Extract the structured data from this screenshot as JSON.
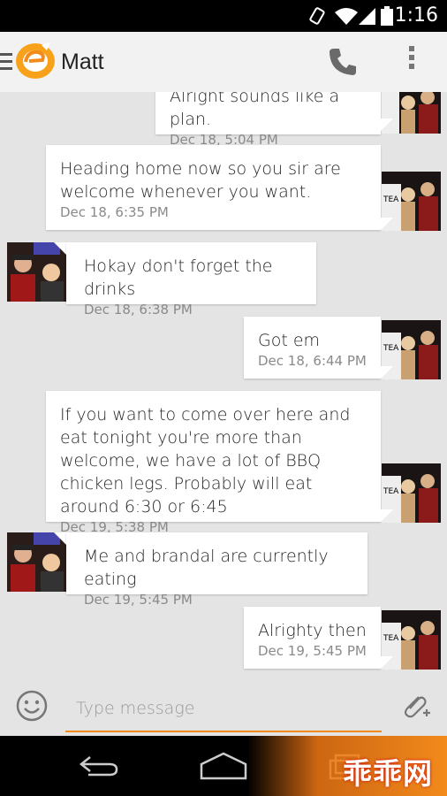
{
  "status_bar": {
    "time": "1:16"
  },
  "header": {
    "title": "Matt"
  },
  "messages": [
    {
      "direction": "out",
      "text": "Alright sounds like a plan.",
      "time": "Dec 18, 5:04 PM"
    },
    {
      "direction": "out",
      "text": "Heading home now so you sir are welcome whenever you want.",
      "time": "Dec 18, 6:35 PM"
    },
    {
      "direction": "in",
      "text": "Hokay don't forget the drinks",
      "time": "Dec 18, 6:38 PM"
    },
    {
      "direction": "out",
      "text": "Got em",
      "time": "Dec 18, 6:44 PM"
    },
    {
      "direction": "out",
      "text": "If you want to come over here and eat tonight you're more than welcome, we have a lot of BBQ chicken legs. Probably will eat around 6:30 or 6:45",
      "time": "Dec 19, 5:38 PM"
    },
    {
      "direction": "in",
      "text": "Me and brandal are currently eating",
      "time": "Dec 19, 5:45 PM"
    },
    {
      "direction": "out",
      "text": "Alrighty then",
      "time": "Dec 19, 5:45 PM"
    }
  ],
  "compose": {
    "placeholder": "Type message"
  },
  "watermark": {
    "text": "乖乖网"
  },
  "colors": {
    "accent": "#f28a1c",
    "background": "#e4e4e4",
    "bubble": "#ffffff"
  },
  "icons": [
    "wifi-icon",
    "signal-icon",
    "battery-icon",
    "vibrate-icon",
    "menu-icon",
    "app-logo-icon",
    "phone-icon",
    "overflow-menu-icon",
    "emoji-icon",
    "attach-icon",
    "back-icon",
    "home-icon",
    "recents-icon"
  ]
}
